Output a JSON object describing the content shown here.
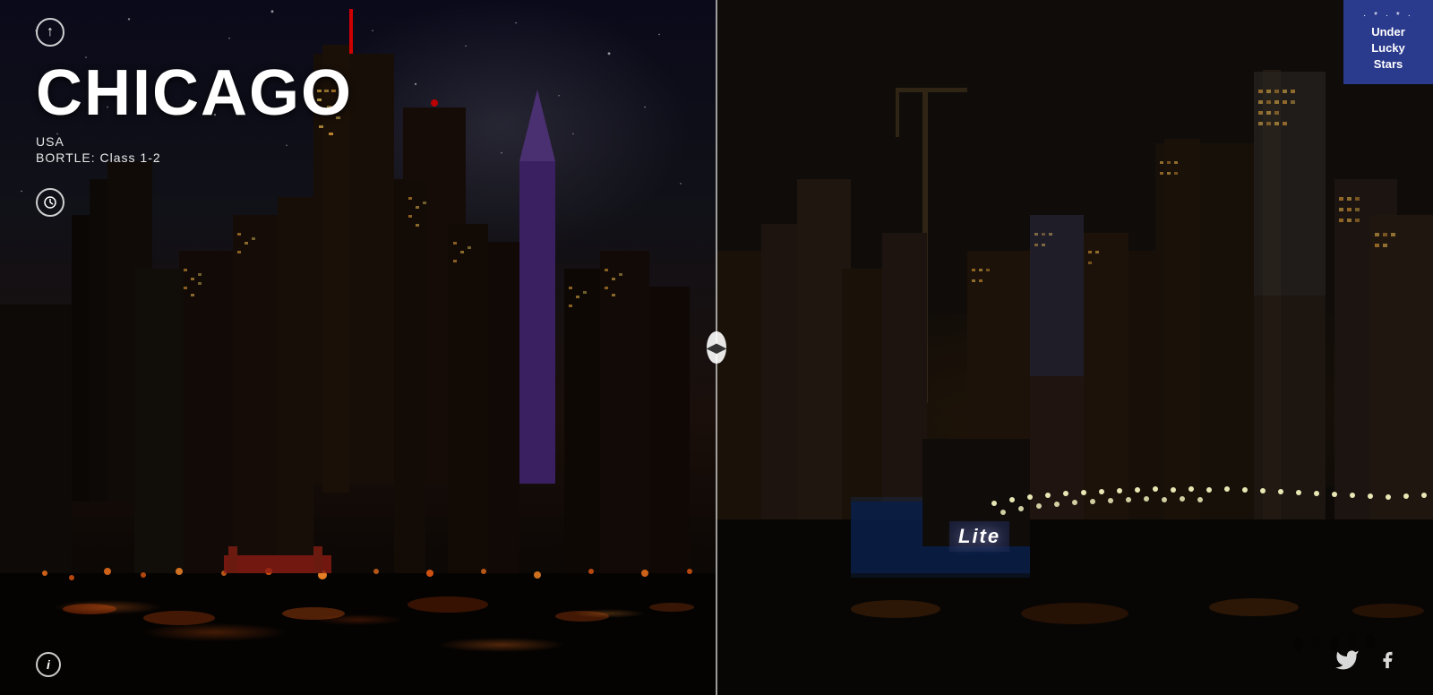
{
  "left_panel": {
    "up_arrow_label": "↑",
    "city_name": "CHICAGO",
    "country": "USA",
    "bortle": "BORTLE: Class 1-2",
    "clock_label": "🕐",
    "info_label": "i"
  },
  "divider": {
    "button_label": "◀▶"
  },
  "right_panel": {
    "lite_sign": "Lite",
    "logo": {
      "stars": "· * · * ·",
      "line1": "Under",
      "line2": "Lucky",
      "line3": "Stars"
    },
    "social": {
      "twitter_label": "🐦",
      "facebook_label": "f"
    }
  }
}
